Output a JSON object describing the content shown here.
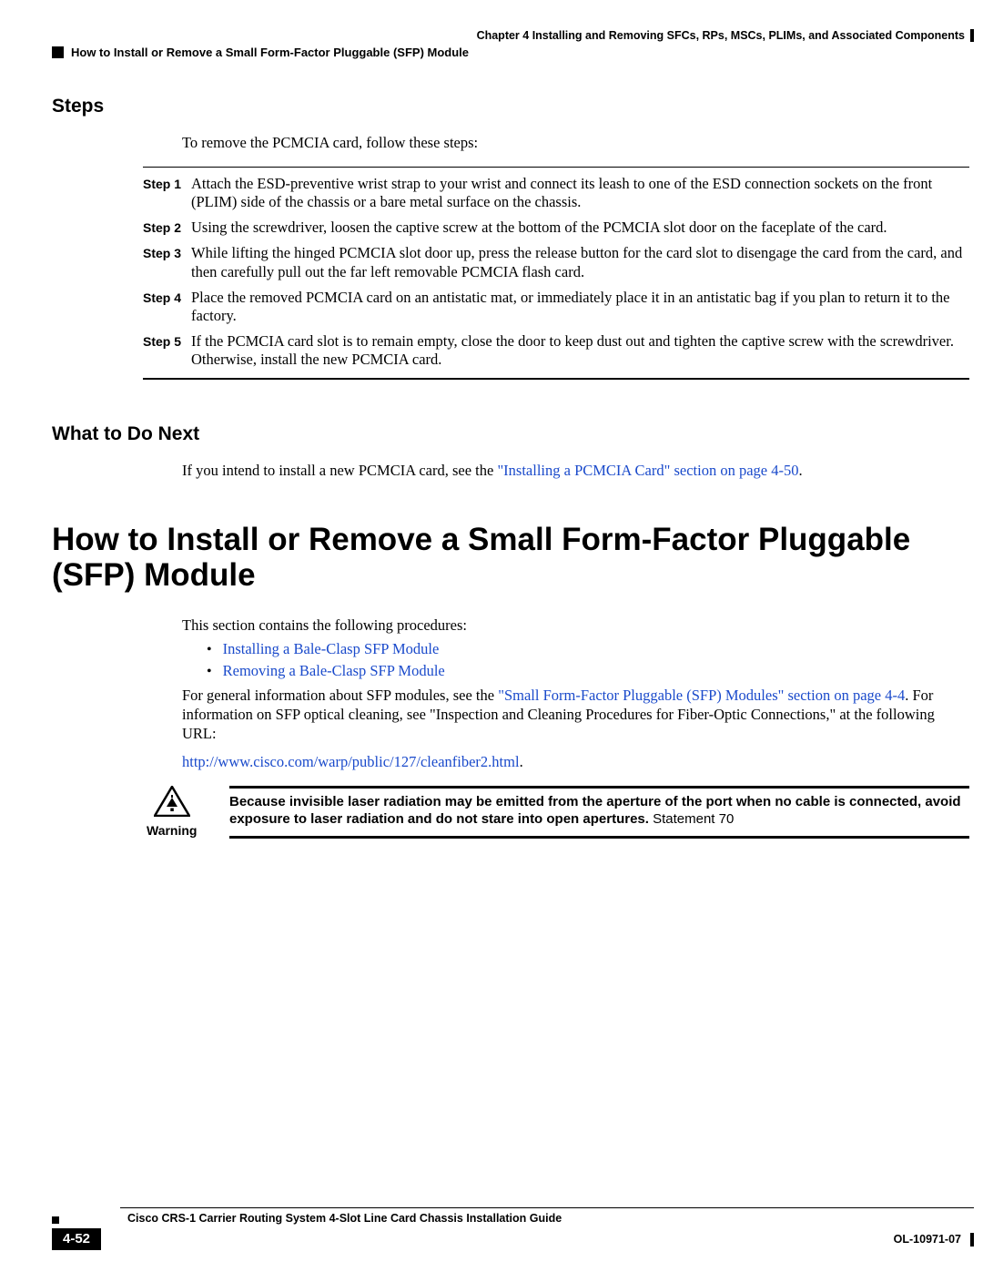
{
  "header": {
    "chapter": "Chapter 4    Installing and Removing SFCs, RPs, MSCs, PLIMs, and Associated Components",
    "section": "How to Install or Remove a Small Form-Factor Pluggable (SFP) Module"
  },
  "steps_section": {
    "heading": "Steps",
    "intro": "To remove the PCMCIA card, follow these steps:",
    "steps": [
      {
        "label": "Step 1",
        "text": "Attach the ESD-preventive wrist strap to your wrist and connect its leash to one of the ESD connection sockets on the front (PLIM) side of the chassis or a bare metal surface on the chassis."
      },
      {
        "label": "Step 2",
        "text": "Using the screwdriver, loosen the captive screw at the bottom of the PCMCIA slot door on the faceplate of the card."
      },
      {
        "label": "Step 3",
        "text": "While lifting the hinged PCMCIA slot door up, press the release button for the card slot to disengage the card from the card, and then carefully pull out the far left removable PCMCIA flash card."
      },
      {
        "label": "Step 4",
        "text": "Place the removed PCMCIA card on an antistatic mat, or immediately place it in an antistatic bag if you plan to return it to the factory."
      },
      {
        "label": "Step 5",
        "text": "If the PCMCIA card slot is to remain empty, close the door to keep dust out and tighten the captive screw with the screwdriver. Otherwise, install the new PCMCIA card."
      }
    ]
  },
  "what_next": {
    "heading": "What to Do Next",
    "text_before": "If you intend to install a new PCMCIA card, see the ",
    "link": "\"Installing a PCMCIA Card\" section on page 4-50",
    "text_after": "."
  },
  "main_heading": "How to Install or Remove a Small Form-Factor Pluggable (SFP) Module",
  "section_intro": "This section contains the following procedures:",
  "bullets": [
    "Installing a Bale-Clasp SFP Module",
    "Removing a Bale-Clasp SFP Module"
  ],
  "para2": {
    "before": "For general information about SFP modules, see the ",
    "link1": "\"Small Form-Factor Pluggable (SFP) Modules\" section on page 4-4",
    "mid": ". For information on SFP optical cleaning, see \"Inspection and Cleaning Procedures for Fiber-Optic Connections,\" at the following URL:"
  },
  "url_link": "http://www.cisco.com/warp/public/127/cleanfiber2.html",
  "url_after": ".",
  "warning": {
    "label": "Warning",
    "text_bold": "Because invisible laser radiation may be emitted from the aperture of the port when no cable is connected, avoid exposure to laser radiation and do not stare into open apertures.",
    "statement": " Statement 70"
  },
  "footer": {
    "guide": "Cisco CRS-1 Carrier Routing System 4-Slot Line Card Chassis Installation Guide",
    "page": "4-52",
    "doc": "OL-10971-07"
  }
}
